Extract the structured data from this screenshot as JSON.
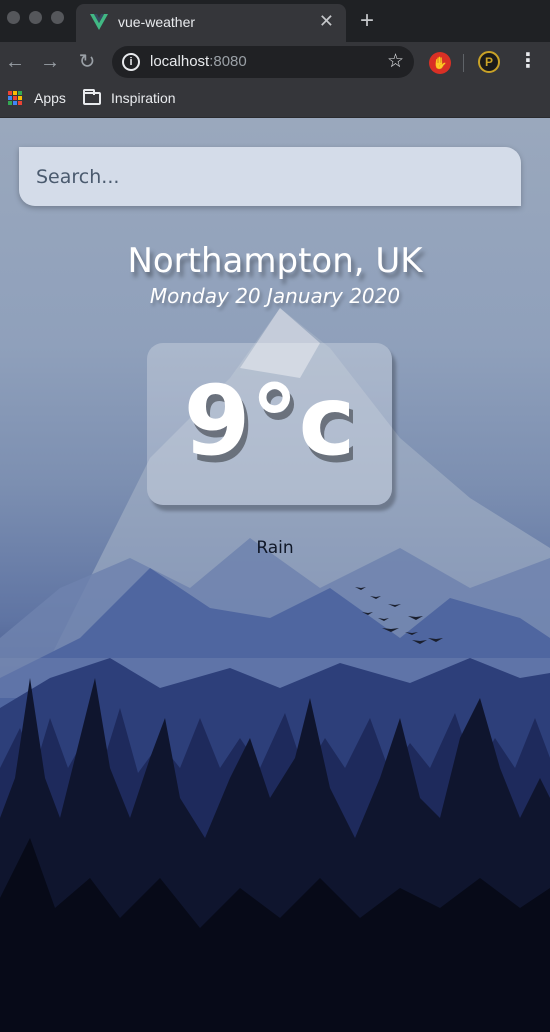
{
  "browser": {
    "tab": {
      "title": "vue-weather",
      "close_icon": "close-icon"
    },
    "new_tab_icon": "plus-icon",
    "address": {
      "host": "localhost",
      "port": ":8080"
    },
    "bookmarks": [
      {
        "label": "Apps"
      },
      {
        "label": "Inspiration"
      }
    ]
  },
  "app": {
    "search": {
      "placeholder": "Search...",
      "value": ""
    },
    "location": "Northampton, UK",
    "date": "Monday 20 January 2020",
    "temperature": "9°c",
    "condition": "Rain"
  },
  "colors": {
    "sky_top": "#9aa8bd",
    "mountain_mid": "#5f74a3",
    "forest_dark": "#0d1125",
    "tab_bg": "#35363a",
    "chrome_bg": "#1f2124"
  }
}
